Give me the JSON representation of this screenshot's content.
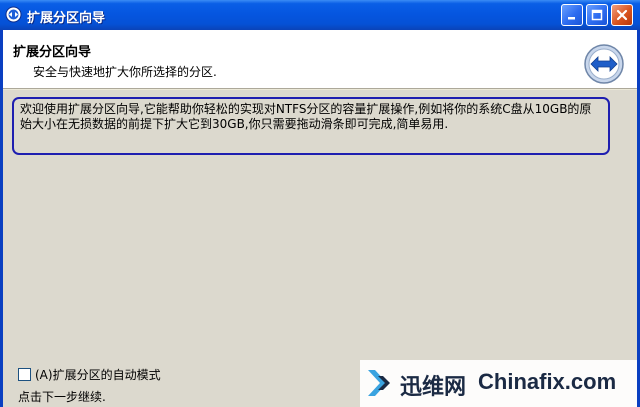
{
  "window": {
    "title": "扩展分区向导"
  },
  "header": {
    "title": "扩展分区向导",
    "subtitle": "安全与快速地扩大你所选择的分区.",
    "icon": "double-arrow-icon"
  },
  "main": {
    "description": "欢迎使用扩展分区向导,它能帮助你轻松的实现对NTFS分区的容量扩展操作,例如将你的系统C盘从10GB的原始大小在无损数据的前提下扩大它到30GB,你只需要拖动滑条即可完成,简单易用.",
    "auto_mode_label": "(A)扩展分区的自动模式",
    "auto_mode_checked": false,
    "next_hint": "点击下一步继续."
  },
  "watermark": {
    "brand_cn": "迅维网",
    "brand_en": "Chinafix.com"
  },
  "colors": {
    "titlebar": "#0556e0",
    "desc_border": "#1e1eb0",
    "close_button": "#d9541f"
  }
}
